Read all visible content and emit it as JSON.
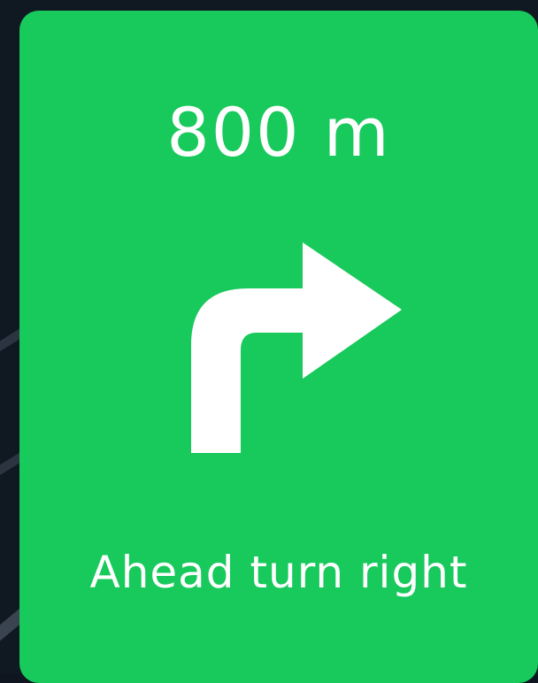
{
  "navigation": {
    "distance": "800 m",
    "instruction": "Ahead turn right",
    "maneuver_icon": "turn-right-icon"
  },
  "colors": {
    "card_background": "#18c95c",
    "text": "#ffffff",
    "map_background": "#101822"
  }
}
